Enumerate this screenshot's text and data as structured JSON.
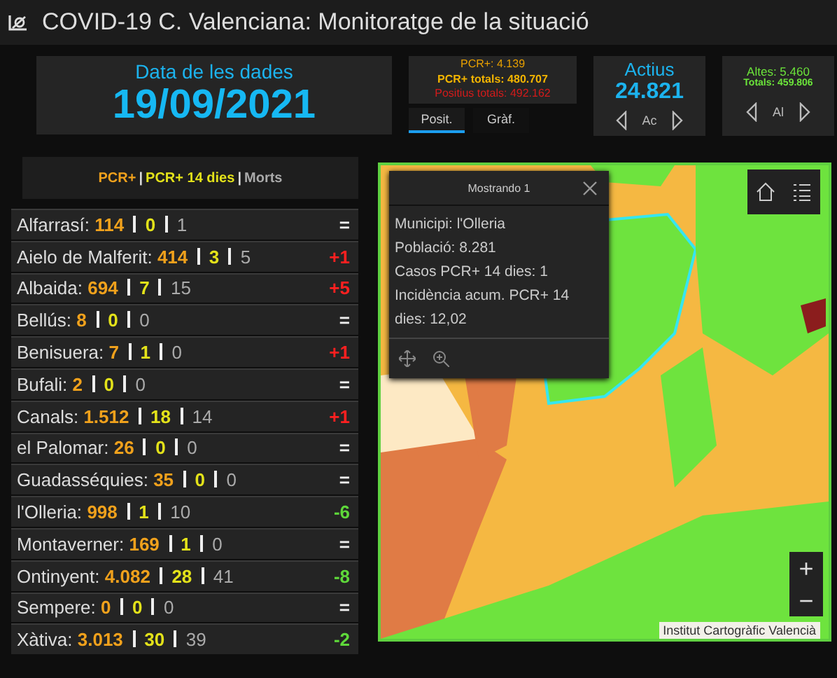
{
  "window": {
    "title": "COVID-19 C. Valenciana: Monitoratge de la situació"
  },
  "date_panel": {
    "label": "Data de les dades",
    "value": "19/09/2021"
  },
  "positives_panel": {
    "lines": [
      {
        "kind": "daily",
        "text": "PCR+: 4.139"
      },
      {
        "kind": "total",
        "text": "PCR+ totals: 480.707"
      },
      {
        "kind": "all",
        "text": "Positius totals: 492.162"
      }
    ],
    "tabs": [
      {
        "label": "Posit.",
        "selected": true
      },
      {
        "label": "Gràf.",
        "selected": false
      }
    ]
  },
  "active_panel": {
    "label": "Actius",
    "value": "24.821",
    "nav_label": "Ac"
  },
  "discharges_panel": {
    "lines": [
      "Altes: 5.460",
      "Totals: 459.806"
    ],
    "nav_label": "Al"
  },
  "list": {
    "legend": [
      {
        "kind": "pcr",
        "text": "PCR+"
      },
      {
        "kind": "sep",
        "text": "|"
      },
      {
        "kind": "pcr14",
        "text": "PCR+ 14 dies"
      },
      {
        "kind": "sep",
        "text": "|"
      },
      {
        "kind": "deaths",
        "text": "Morts"
      }
    ],
    "rows": [
      {
        "name": "Alfarrasí:",
        "pcr": "114",
        "pcr14": "0",
        "deaths": "1",
        "change": "=",
        "kind": "same"
      },
      {
        "name": "Aielo de Malferit:",
        "pcr": "414",
        "pcr14": "3",
        "deaths": "5",
        "change": "+1",
        "kind": "up"
      },
      {
        "name": "Albaida:",
        "pcr": "694",
        "pcr14": "7",
        "deaths": "15",
        "change": "+5",
        "kind": "up"
      },
      {
        "name": "Bellús:",
        "pcr": "8",
        "pcr14": "0",
        "deaths": "0",
        "change": "=",
        "kind": "same"
      },
      {
        "name": "Benisuera:",
        "pcr": "7",
        "pcr14": "1",
        "deaths": "0",
        "change": "+1",
        "kind": "up"
      },
      {
        "name": "Bufali:",
        "pcr": "2",
        "pcr14": "0",
        "deaths": "0",
        "change": "=",
        "kind": "same"
      },
      {
        "name": "Canals:",
        "pcr": "1.512",
        "pcr14": "18",
        "deaths": "14",
        "change": "+1",
        "kind": "up"
      },
      {
        "name": "el Palomar:",
        "pcr": "26",
        "pcr14": "0",
        "deaths": "0",
        "change": "=",
        "kind": "same"
      },
      {
        "name": "Guadasséquies:",
        "pcr": "35",
        "pcr14": "0",
        "deaths": "0",
        "change": "=",
        "kind": "same"
      },
      {
        "name": "l'Olleria:",
        "pcr": "998",
        "pcr14": "1",
        "deaths": "10",
        "change": "-6",
        "kind": "down"
      },
      {
        "name": "Montaverner:",
        "pcr": "169",
        "pcr14": "1",
        "deaths": "0",
        "change": "=",
        "kind": "same"
      },
      {
        "name": "Ontinyent:",
        "pcr": "4.082",
        "pcr14": "28",
        "deaths": "41",
        "change": "-8",
        "kind": "down"
      },
      {
        "name": "Sempere:",
        "pcr": "0",
        "pcr14": "0",
        "deaths": "0",
        "change": "=",
        "kind": "same"
      },
      {
        "name": "Xàtiva:",
        "pcr": "3.013",
        "pcr14": "30",
        "deaths": "39",
        "change": "-2",
        "kind": "down"
      }
    ]
  },
  "map": {
    "popup": {
      "title": "Mostrando 1",
      "lines": [
        "Municipi: l'Olleria",
        "Població: 8.281",
        "Casos PCR+ 14 dies: 1",
        "Incidència acum. PCR+ 14 dies: 12,02"
      ]
    },
    "attribution": "Institut Cartogràfic Valencià",
    "zoom_buttons": [
      "+",
      "−"
    ]
  }
}
